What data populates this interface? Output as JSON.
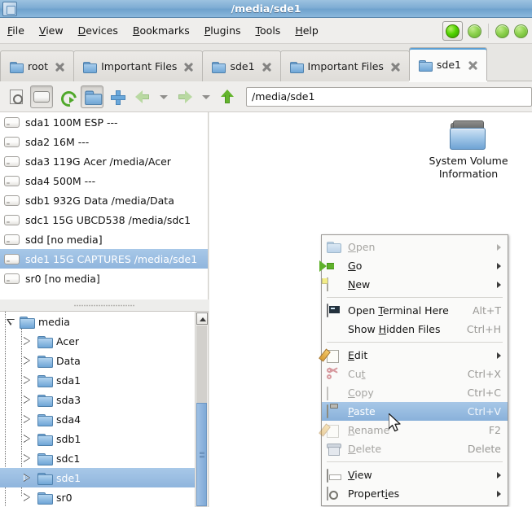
{
  "window": {
    "title": "/media/sde1",
    "app_icon": "box-icon"
  },
  "menubar": {
    "items": [
      {
        "label": "File",
        "mnemonic": "F"
      },
      {
        "label": "View",
        "mnemonic": "V"
      },
      {
        "label": "Devices",
        "mnemonic": "D"
      },
      {
        "label": "Bookmarks",
        "mnemonic": "B"
      },
      {
        "label": "Plugins",
        "mnemonic": "P"
      },
      {
        "label": "Tools",
        "mnemonic": "T"
      },
      {
        "label": "Help",
        "mnemonic": "H"
      }
    ],
    "status_lights": [
      "active-green",
      "green",
      "green",
      "green"
    ]
  },
  "tabs": [
    {
      "label": "root",
      "active": false
    },
    {
      "label": "Important Files",
      "active": false
    },
    {
      "label": "sde1",
      "active": false
    },
    {
      "label": "Important Files",
      "active": false
    },
    {
      "label": "sde1",
      "active": true
    }
  ],
  "toolbar": {
    "buttons": [
      {
        "name": "properties",
        "icon": "properties-icon"
      },
      {
        "name": "devices",
        "icon": "drive-icon"
      },
      {
        "name": "refresh",
        "icon": "refresh-icon"
      },
      {
        "name": "new-folder",
        "icon": "folder-icon"
      },
      {
        "name": "new-tab",
        "icon": "plus-icon"
      },
      {
        "name": "back",
        "icon": "arrow-left-icon"
      },
      {
        "name": "back-history",
        "icon": "chevron-down-icon"
      },
      {
        "name": "forward",
        "icon": "arrow-right-icon"
      },
      {
        "name": "forward-history",
        "icon": "chevron-down-icon"
      },
      {
        "name": "up",
        "icon": "arrow-up-icon"
      }
    ],
    "path_value": "/media/sde1"
  },
  "devices": [
    {
      "label": "sda1 100M ESP ---",
      "selected": false
    },
    {
      "label": "sda2 16M ---",
      "selected": false
    },
    {
      "label": "sda3 119G Acer /media/Acer",
      "selected": false
    },
    {
      "label": "sda4 500M ---",
      "selected": false
    },
    {
      "label": "sdb1 932G Data /media/Data",
      "selected": false
    },
    {
      "label": "sdc1 15G UBCD538 /media/sdc1",
      "selected": false
    },
    {
      "label": "sdd [no media]",
      "selected": false
    },
    {
      "label": "sde1 15G CAPTURES /media/sde1",
      "selected": true
    },
    {
      "label": "sr0 [no media]",
      "selected": false
    }
  ],
  "tree": {
    "nodes": [
      {
        "label": "media",
        "depth": 0,
        "state": "expanded",
        "selected": false
      },
      {
        "label": "Acer",
        "depth": 1,
        "state": "collapsed",
        "selected": false
      },
      {
        "label": "Data",
        "depth": 1,
        "state": "collapsed",
        "selected": false
      },
      {
        "label": "sda1",
        "depth": 1,
        "state": "collapsed",
        "selected": false
      },
      {
        "label": "sda3",
        "depth": 1,
        "state": "collapsed",
        "selected": false
      },
      {
        "label": "sda4",
        "depth": 1,
        "state": "collapsed",
        "selected": false
      },
      {
        "label": "sdb1",
        "depth": 1,
        "state": "collapsed",
        "selected": false
      },
      {
        "label": "sdc1",
        "depth": 1,
        "state": "collapsed",
        "selected": false
      },
      {
        "label": "sde1",
        "depth": 1,
        "state": "collapsed",
        "selected": true
      },
      {
        "label": "sr0",
        "depth": 1,
        "state": "collapsed",
        "selected": false
      }
    ]
  },
  "files": [
    {
      "name": "System Volume Information",
      "line1": "System Volume",
      "line2": "Information",
      "icon": "folder-icon"
    }
  ],
  "context_menu": {
    "items": [
      {
        "type": "item",
        "label": "Open",
        "mnemonic": "O",
        "pre": "",
        "post": "pen",
        "icon": "folder-icon",
        "shortcut": "",
        "submenu": true,
        "disabled": true,
        "highlighted": false
      },
      {
        "type": "item",
        "label": "Go",
        "mnemonic": "G",
        "pre": "",
        "post": "o",
        "icon": "green-arrow-icon",
        "shortcut": "",
        "submenu": true,
        "disabled": false,
        "highlighted": false
      },
      {
        "type": "item",
        "label": "New",
        "mnemonic": "N",
        "pre": "",
        "post": "ew",
        "icon": "new-page-icon",
        "shortcut": "",
        "submenu": true,
        "disabled": false,
        "highlighted": false
      },
      {
        "type": "separator"
      },
      {
        "type": "item",
        "label": "Open Terminal Here",
        "mnemonic": "T",
        "pre": "Open ",
        "post": "erminal Here",
        "icon": "terminal-icon",
        "shortcut": "Alt+T",
        "submenu": false,
        "disabled": false,
        "highlighted": false
      },
      {
        "type": "item",
        "label": "Show Hidden Files",
        "mnemonic": "H",
        "pre": "Show ",
        "post": "idden Files",
        "icon": "none",
        "shortcut": "Ctrl+H",
        "submenu": false,
        "disabled": false,
        "highlighted": false
      },
      {
        "type": "separator"
      },
      {
        "type": "item",
        "label": "Edit",
        "mnemonic": "E",
        "pre": "",
        "post": "dit",
        "icon": "pencil-icon",
        "shortcut": "",
        "submenu": true,
        "disabled": false,
        "highlighted": false
      },
      {
        "type": "item",
        "label": "Cut",
        "mnemonic": "t",
        "pre": "Cu",
        "post": "",
        "icon": "scissors-icon",
        "shortcut": "Ctrl+X",
        "submenu": false,
        "disabled": true,
        "highlighted": false
      },
      {
        "type": "item",
        "label": "Copy",
        "mnemonic": "C",
        "pre": "",
        "post": "opy",
        "icon": "copy-icon",
        "shortcut": "Ctrl+C",
        "submenu": false,
        "disabled": true,
        "highlighted": false
      },
      {
        "type": "item",
        "label": "Paste",
        "mnemonic": "P",
        "pre": "",
        "post": "aste",
        "icon": "clipboard-icon",
        "shortcut": "Ctrl+V",
        "submenu": false,
        "disabled": false,
        "highlighted": true
      },
      {
        "type": "item",
        "label": "Rename",
        "mnemonic": "R",
        "pre": "",
        "post": "ename",
        "icon": "pencil-icon",
        "shortcut": "F2",
        "submenu": false,
        "disabled": true,
        "highlighted": false
      },
      {
        "type": "item",
        "label": "Delete",
        "mnemonic": "D",
        "pre": "",
        "post": "elete",
        "icon": "trash-icon",
        "shortcut": "Delete",
        "submenu": false,
        "disabled": true,
        "highlighted": false
      },
      {
        "type": "separator"
      },
      {
        "type": "item",
        "label": "View",
        "mnemonic": "V",
        "pre": "",
        "post": "iew",
        "icon": "view-icon",
        "shortcut": "",
        "submenu": true,
        "disabled": false,
        "highlighted": false
      },
      {
        "type": "item",
        "label": "Properties",
        "mnemonic": "i",
        "pre": "Propert",
        "post": "es",
        "icon": "properties-icon",
        "shortcut": "",
        "submenu": true,
        "disabled": false,
        "highlighted": false
      }
    ]
  },
  "colors": {
    "titlebar": "#7fadd4",
    "selection": "#8fb5dd",
    "accent_tab": "#5a9fd4",
    "window_bg": "#efeeec",
    "status_green": "#52d400"
  }
}
